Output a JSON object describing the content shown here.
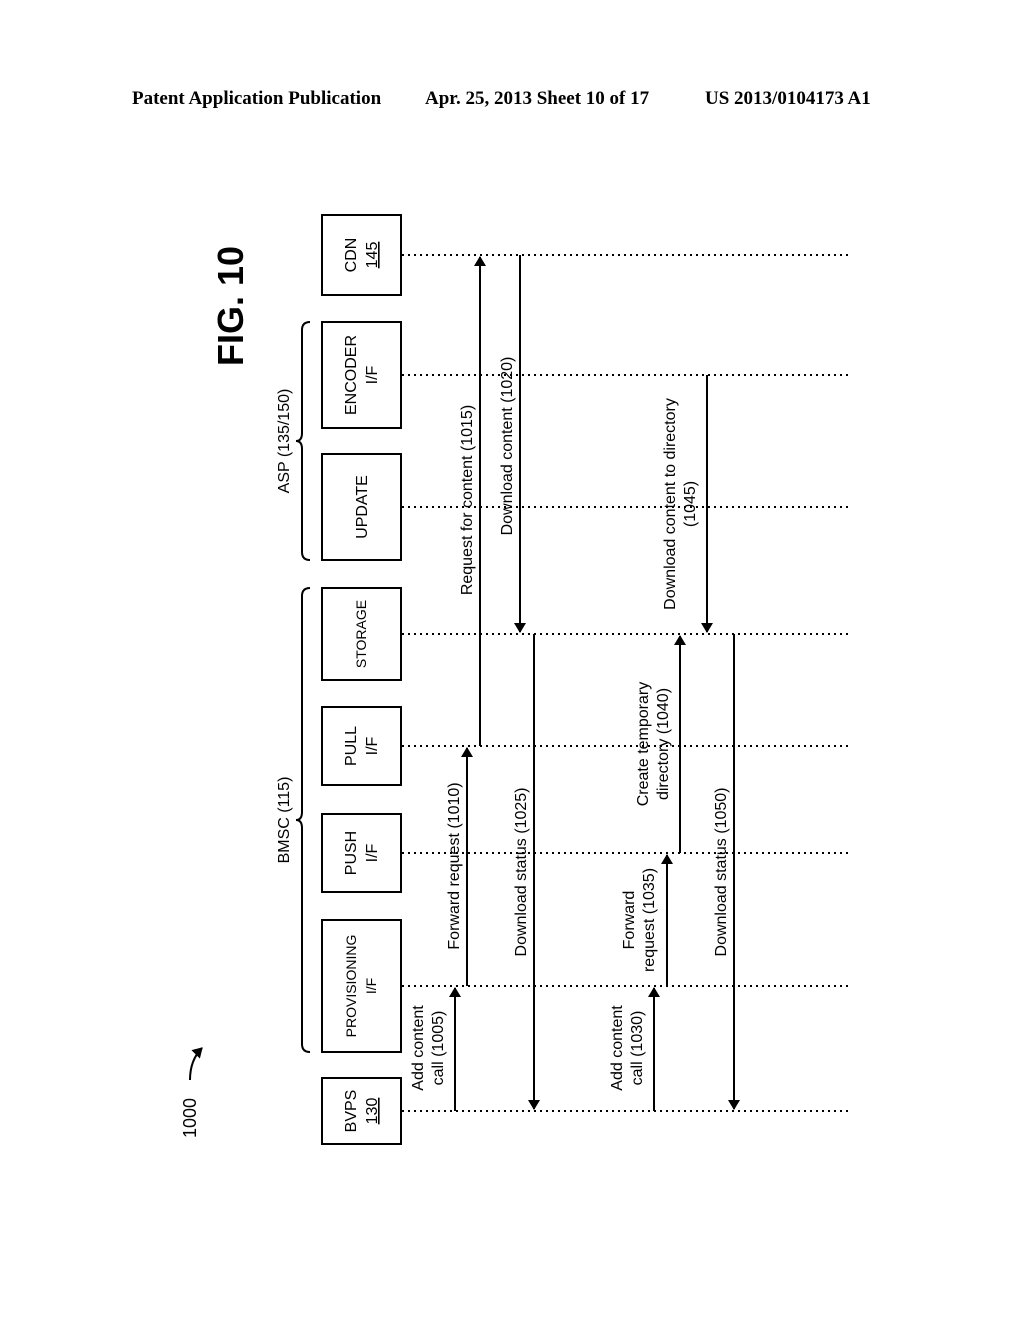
{
  "header": {
    "left": "Patent Application Publication",
    "middle": "Apr. 25, 2013  Sheet 10 of 17",
    "right": "US 2013/0104173 A1"
  },
  "figure": {
    "title": "FIG. 10",
    "ref": "1000"
  },
  "groups": {
    "bmsc": "BMSC (115)",
    "asp": "ASP (135/150)"
  },
  "entities": {
    "bvps": {
      "line1": "BVPS",
      "line2": "130"
    },
    "provisioning": {
      "line1": "PROVISIONING",
      "line2": "I/F"
    },
    "push": {
      "line1": "PUSH",
      "line2": "I/F"
    },
    "pull": {
      "line1": "PULL",
      "line2": "I/F"
    },
    "storage": {
      "line1": "STORAGE"
    },
    "update": {
      "line1": "UPDATE"
    },
    "encoder": {
      "line1": "ENCODER",
      "line2": "I/F"
    },
    "cdn": {
      "line1": "CDN",
      "line2": "145"
    }
  },
  "messages": {
    "m1005": {
      "line1": "Add content",
      "line2": "call (1005)"
    },
    "m1010": {
      "line1": "Forward request (1010)"
    },
    "m1015": {
      "line1": "Request for content (1015)"
    },
    "m1020": {
      "line1": "Download content (1020)"
    },
    "m1025": {
      "line1": "Download status (1025)"
    },
    "m1030": {
      "line1": "Add content",
      "line2": "call (1030)"
    },
    "m1035": {
      "line1": "Forward",
      "line2": "request (1035)"
    },
    "m1040": {
      "line1": "Create temporary",
      "line2": "directory (1040)"
    },
    "m1045": {
      "line1": "Download content to directory",
      "line2": "(1045)"
    },
    "m1050": {
      "line1": "Download status (1050)"
    }
  }
}
